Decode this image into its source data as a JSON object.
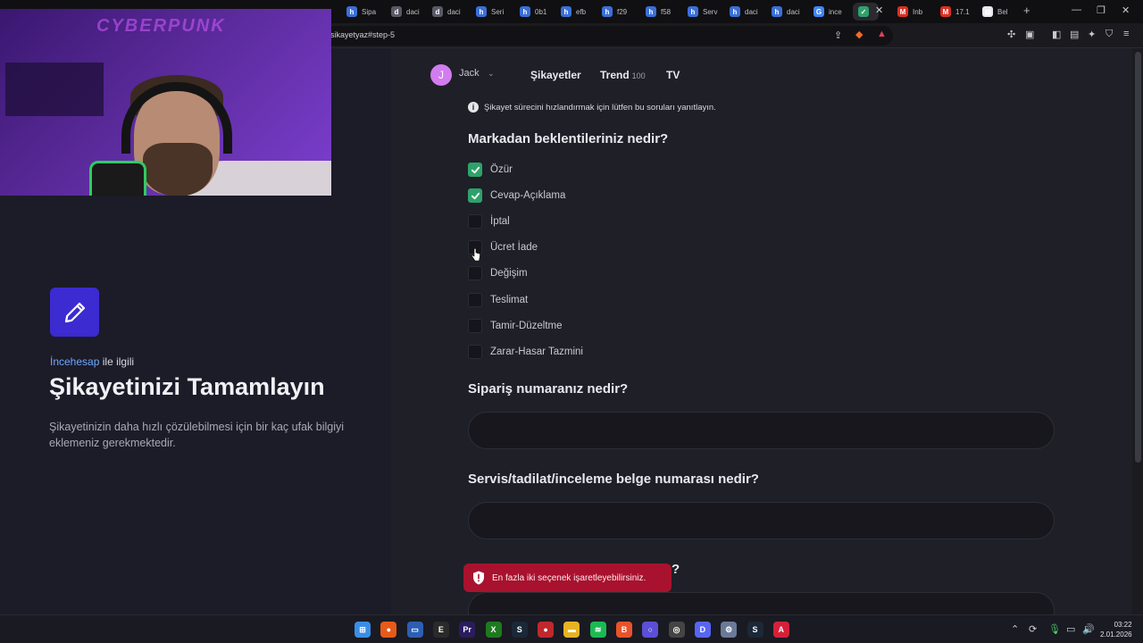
{
  "browser": {
    "tabs": [
      {
        "label": "Sipa",
        "icon": "tab-favicon",
        "color": "#3b6fd8",
        "glyph": "h"
      },
      {
        "label": "daci",
        "icon": "tab-favicon",
        "color": "#5a5a66",
        "glyph": "d"
      },
      {
        "label": "daci",
        "icon": "tab-favicon",
        "color": "#5a5a66",
        "glyph": "d"
      },
      {
        "label": "Seri",
        "icon": "tab-favicon",
        "color": "#3b6fd8",
        "glyph": "h"
      },
      {
        "label": "0b1",
        "icon": "tab-favicon",
        "color": "#3b6fd8",
        "glyph": "h"
      },
      {
        "label": "efb",
        "icon": "tab-favicon",
        "color": "#3b6fd8",
        "glyph": "h"
      },
      {
        "label": "f29",
        "icon": "tab-favicon",
        "color": "#3b6fd8",
        "glyph": "h"
      },
      {
        "label": "f58",
        "icon": "tab-favicon",
        "color": "#3b6fd8",
        "glyph": "h"
      },
      {
        "label": "Serv",
        "icon": "tab-favicon",
        "color": "#3b6fd8",
        "glyph": "h"
      },
      {
        "label": "daci",
        "icon": "tab-favicon",
        "color": "#3b6fd8",
        "glyph": "h"
      },
      {
        "label": "daci",
        "icon": "tab-favicon",
        "color": "#3b6fd8",
        "glyph": "h"
      },
      {
        "label": "ince",
        "icon": "tab-favicon",
        "color": "#4285f4",
        "glyph": "G"
      },
      {
        "label": "",
        "icon": "tab-favicon",
        "color": "#2ea26b",
        "glyph": "✓"
      },
      {
        "label": "Inb",
        "icon": "tab-favicon",
        "color": "#d93025",
        "glyph": "M"
      },
      {
        "label": "17.1",
        "icon": "tab-favicon",
        "color": "#d93025",
        "glyph": "M"
      },
      {
        "label": "Bel",
        "icon": "tab-favicon",
        "color": "#e8e8ee",
        "glyph": "▤"
      }
    ],
    "url": "sikayetyaz#step-5"
  },
  "webcam": {
    "sign_text": "CYBERPUNK"
  },
  "left": {
    "brand": "İncehesap",
    "brand_suffix": "ile ilgili",
    "title": "Şikayetinizi Tamamlayın",
    "description": "Şikayetinizin daha hızlı çözülebilmesi için bir kaç ufak bilgiyi eklemeniz gerekmektedir."
  },
  "header": {
    "avatar_letter": "J",
    "user_name": "Jack",
    "nav": [
      {
        "label": "Şikayetler",
        "count": ""
      },
      {
        "label": "Trend",
        "count": "100"
      },
      {
        "label": "TV",
        "count": ""
      }
    ]
  },
  "form": {
    "info": "Şikayet sürecini hızlandırmak için lütfen bu soruları yanıtlayın.",
    "q1": "Markadan beklentileriniz nedir?",
    "options": [
      {
        "label": "Özür",
        "checked": true
      },
      {
        "label": "Cevap-Açıklama",
        "checked": true
      },
      {
        "label": "İptal",
        "checked": false
      },
      {
        "label": "Ücret İade",
        "checked": false
      },
      {
        "label": "Değişim",
        "checked": false
      },
      {
        "label": "Teslimat",
        "checked": false
      },
      {
        "label": "Tamir-Düzeltme",
        "checked": false
      },
      {
        "label": "Zarar-Hasar Tazmini",
        "checked": false
      }
    ],
    "q2": "Sipariş numaranız nedir?",
    "q2_value": "",
    "q3": "Servis/tadilat/inceleme belge numarası nedir?",
    "q3_value": "",
    "q4_partial": "?",
    "q4_value": ""
  },
  "toast": {
    "message": "En fazla iki seçenek işaretleyebilirsiniz.",
    "color": "#a8122e"
  },
  "taskbar": {
    "apps": [
      {
        "name": "windows-start-icon",
        "color": "#3a8ee6",
        "glyph": "⊞"
      },
      {
        "name": "app-orange-icon",
        "color": "#e65a1a",
        "glyph": "●"
      },
      {
        "name": "monitor-app-icon",
        "color": "#2c5fb3",
        "glyph": "▭"
      },
      {
        "name": "epic-games-icon",
        "color": "#2a2a2a",
        "glyph": "E"
      },
      {
        "name": "premiere-icon",
        "color": "#2a1c5e",
        "glyph": "Pr"
      },
      {
        "name": "xbox-icon",
        "color": "#1e7a1e",
        "glyph": "X"
      },
      {
        "name": "steam-icon",
        "color": "#1b2838",
        "glyph": "S"
      },
      {
        "name": "red-app-icon",
        "color": "#c0282e",
        "glyph": "●"
      },
      {
        "name": "file-explorer-icon",
        "color": "#e6b422",
        "glyph": "▬"
      },
      {
        "name": "spotify-icon",
        "color": "#1db954",
        "glyph": "≋"
      },
      {
        "name": "brave-icon",
        "color": "#e8532a",
        "glyph": "B"
      },
      {
        "name": "circle-app-icon",
        "color": "#5b4fd6",
        "glyph": "○"
      },
      {
        "name": "obs-icon",
        "color": "#444",
        "glyph": "◎"
      },
      {
        "name": "discord-icon",
        "color": "#5865f2",
        "glyph": "D"
      },
      {
        "name": "settings-icon",
        "color": "#6b7a99",
        "glyph": "⚙"
      },
      {
        "name": "steam-icon-2",
        "color": "#1b2838",
        "glyph": "S"
      },
      {
        "name": "amd-icon",
        "color": "#d6203a",
        "glyph": "A"
      }
    ],
    "time": "03:22",
    "date": "2.01.2026"
  }
}
